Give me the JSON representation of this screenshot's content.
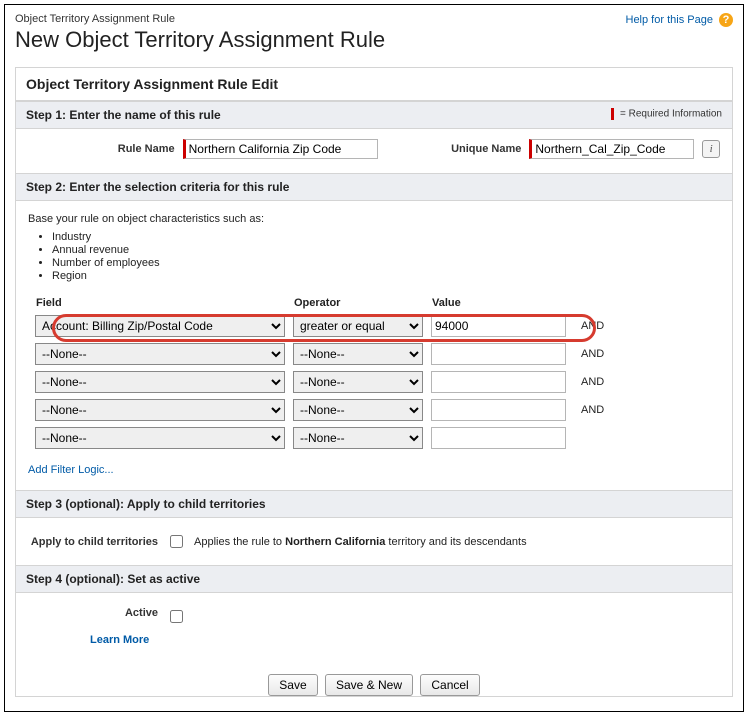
{
  "help": {
    "label": "Help for this Page",
    "glyph": "?"
  },
  "crumb": "Object Territory Assignment Rule",
  "title": "New Object Territory Assignment Rule",
  "panel_head": "Object Territory Assignment Rule Edit",
  "step1": {
    "head": "Step 1: Enter the name of this rule",
    "req_text": "= Required Information",
    "rule_name_label": "Rule Name",
    "rule_name_value": "Northern California Zip Code",
    "unique_name_label": "Unique Name",
    "unique_name_value": "Northern_Cal_Zip_Code",
    "info_glyph": "i"
  },
  "step2": {
    "head": "Step 2: Enter the selection criteria for this rule",
    "base_text": "Base your rule on object characteristics such as:",
    "chars": [
      "Industry",
      "Annual revenue",
      "Number of employees",
      "Region"
    ],
    "col_field": "Field",
    "col_op": "Operator",
    "col_val": "Value",
    "and": "AND",
    "rows": [
      {
        "field": "Account: Billing Zip/Postal Code",
        "op": "greater or equal",
        "val": "94000",
        "show_and": true
      },
      {
        "field": "--None--",
        "op": "--None--",
        "val": "",
        "show_and": true
      },
      {
        "field": "--None--",
        "op": "--None--",
        "val": "",
        "show_and": true
      },
      {
        "field": "--None--",
        "op": "--None--",
        "val": "",
        "show_and": true
      },
      {
        "field": "--None--",
        "op": "--None--",
        "val": "",
        "show_and": false
      }
    ],
    "add_filter": "Add Filter Logic..."
  },
  "step3": {
    "head": "Step 3 (optional): Apply to child territories",
    "label": "Apply to child territories",
    "text_pre": "Applies the rule to ",
    "text_bold": "Northern California",
    "text_post": " territory and its descendants"
  },
  "step4": {
    "head": "Step 4 (optional): Set as active",
    "label": "Active",
    "learn": "Learn More"
  },
  "buttons": {
    "save": "Save",
    "save_new": "Save & New",
    "cancel": "Cancel"
  }
}
